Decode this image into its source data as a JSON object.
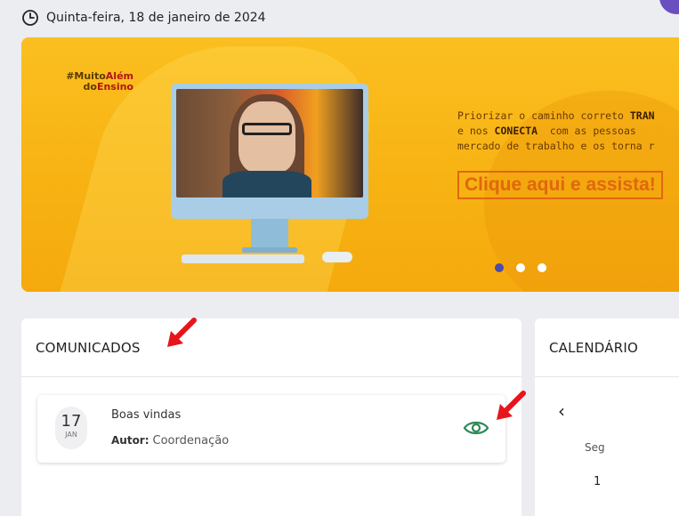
{
  "header": {
    "date_text": "Quinta-feira, 18 de janeiro de 2024",
    "clock_icon": "clock-icon"
  },
  "banner": {
    "hashtag_line1_a": "#Muito",
    "hashtag_line1_b": "Além",
    "hashtag_line2_a": "do",
    "hashtag_line2_b": "Ensino",
    "promo_line1_a": "Priorizar o caminho correto ",
    "promo_line1_b": "TRAN",
    "promo_line2_a": "e nos ",
    "promo_line2_b": "CONECTA",
    "promo_line2_c": "  com as pessoas",
    "promo_line3": "mercado de trabalho e os torna r",
    "cta_label": "Clique aqui e assista!",
    "carousel_active_index": 0,
    "carousel_count": 3,
    "accent_color": "#f7b313"
  },
  "comunicados": {
    "title": "COMUNICADOS",
    "items": [
      {
        "day": "17",
        "month": "JAN",
        "title": "Boas vindas",
        "author_label": "Autor:",
        "author": "Coordenação",
        "view_icon": "eye-icon"
      }
    ]
  },
  "calendario": {
    "title": "CALENDÁRIO",
    "prev_icon": "chevron-left-icon",
    "weekday": "Seg",
    "day": "1"
  },
  "colors": {
    "eye_green": "#2e8b57",
    "arrow_red": "#e8141c",
    "carousel_active": "#4a4ca8"
  }
}
